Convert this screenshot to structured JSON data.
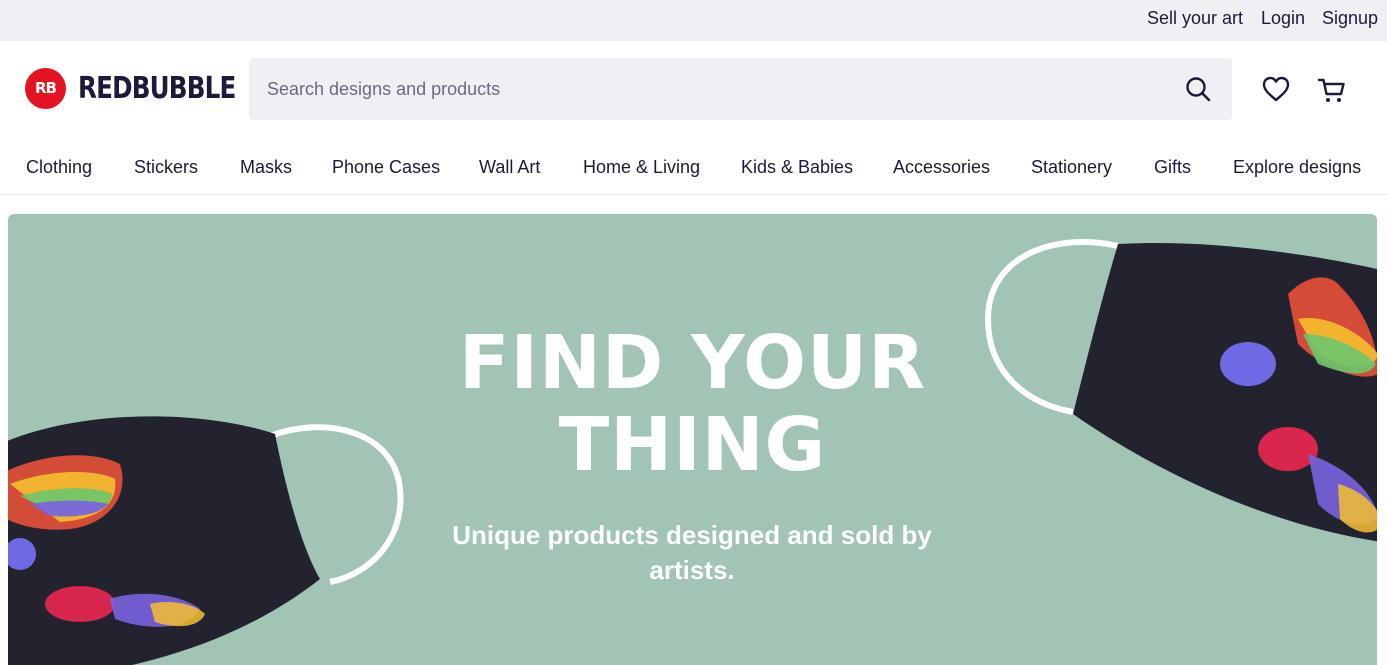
{
  "top_bar": {
    "sell_label": "Sell your art",
    "login_label": "Login",
    "signup_label": "Signup"
  },
  "header": {
    "logo_text": "REDBUBBLE",
    "logo_mark_text": "RB",
    "search_placeholder": "Search designs and products",
    "search_value": "",
    "icons": [
      "search-icon",
      "heart-icon",
      "cart-icon"
    ]
  },
  "nav": {
    "items": [
      {
        "label": "Clothing"
      },
      {
        "label": "Stickers"
      },
      {
        "label": "Masks"
      },
      {
        "label": "Phone Cases"
      },
      {
        "label": "Wall Art"
      },
      {
        "label": "Home & Living"
      },
      {
        "label": "Kids & Babies"
      },
      {
        "label": "Accessories"
      },
      {
        "label": "Stationery"
      },
      {
        "label": "Gifts"
      },
      {
        "label": "Explore designs"
      }
    ]
  },
  "hero": {
    "title_line1": "FIND YOUR",
    "title_line2": "THING",
    "subtitle": "Unique products designed and sold by artists.",
    "background_color": "#a1c4b4"
  },
  "colors": {
    "brand": "#e41321",
    "text": "#1c1b3a",
    "utility_bar": "#f0eff4"
  }
}
